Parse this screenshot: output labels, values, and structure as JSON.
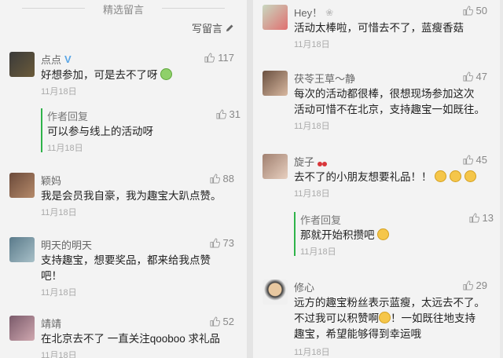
{
  "header": {
    "title": "精选留言",
    "write_label": "写留言"
  },
  "left": [
    {
      "name": "点点",
      "verified": true,
      "likes": "117",
      "text": "好想参加，可是去不了呀",
      "date": "11月18日",
      "reply": {
        "author": "作者回复",
        "likes": "31",
        "text": "可以参与线上的活动呀",
        "date": "11月18日"
      }
    },
    {
      "name": "颖妈",
      "likes": "88",
      "text": "我是会员我自豪，我为趣宝大趴点赞。",
      "date": "11月18日"
    },
    {
      "name": "明天的明天",
      "likes": "73",
      "text_lines": [
        "支持趣宝，想要奖品，都来给我点赞",
        "吧！"
      ],
      "date": "11月18日"
    },
    {
      "name": "靖靖",
      "likes": "52",
      "text": "在北京去不了 一直关注qooboo 求礼品",
      "date": "11月18日"
    }
  ],
  "right": [
    {
      "name": "Hey！",
      "likes": "50",
      "text": "活动太棒啦，可惜去不了，蓝瘦香菇",
      "date": "11月18日"
    },
    {
      "name": "茯苓王草～静",
      "likes": "47",
      "text_lines": [
        "每次的活动都很棒，很想现场参加这次",
        "活动可惜不在北京，支持趣宝一如既往。"
      ],
      "date": "11月18日"
    },
    {
      "name": "旋子",
      "likes": "45",
      "text": "去不了的小朋友想要礼品！！",
      "date": "11月18日",
      "reply": {
        "author": "作者回复",
        "likes": "13",
        "text": "那就开始积攒吧",
        "date": "11月18日"
      }
    },
    {
      "name": "修心",
      "likes": "29",
      "text_lines": [
        "远方的趣宝粉丝表示蓝瘦，太远去不了。",
        "不过我可以积赞啊",
        "！一如既往地支持",
        "趣宝，希望能够得到幸运哦"
      ],
      "date": "11月18日"
    }
  ]
}
